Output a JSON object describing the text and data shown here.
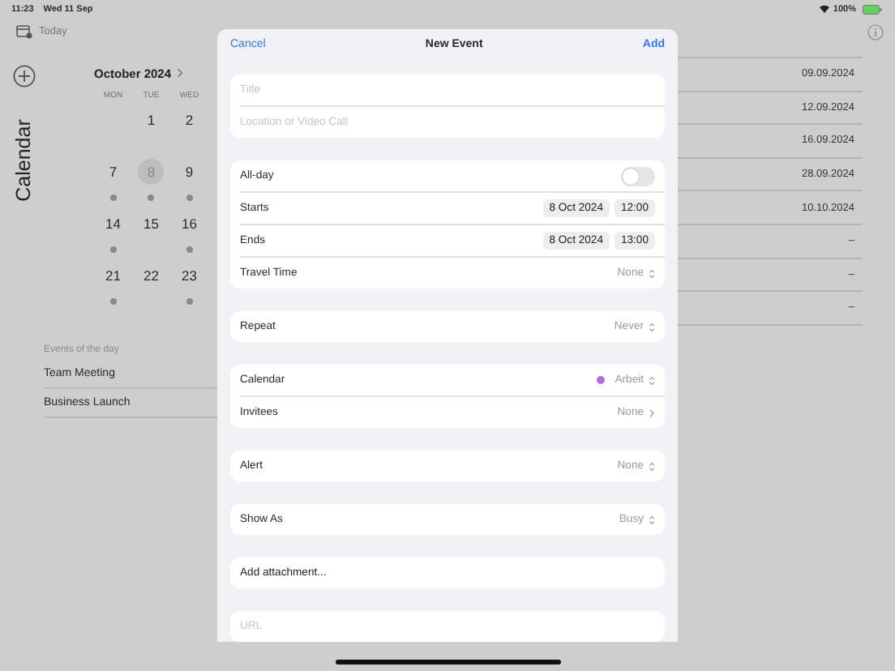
{
  "status_bar": {
    "time": "11:23",
    "date": "Wed 11 Sep",
    "battery": "100%"
  },
  "toolbar": {
    "today": "Today"
  },
  "sidebar": {
    "title": "Calendar"
  },
  "month": {
    "title": "October 2024",
    "weekdays": [
      "MON",
      "TUE",
      "WED"
    ],
    "weeks": [
      [
        {
          "day": "1",
          "has_events": false,
          "selected": false
        },
        {
          "day": "2",
          "has_events": false,
          "selected": false
        }
      ],
      [
        {
          "day": "7",
          "has_events": true,
          "selected": false
        },
        {
          "day": "8",
          "has_events": true,
          "selected": true
        },
        {
          "day": "9",
          "has_events": true,
          "selected": false
        }
      ],
      [
        {
          "day": "14",
          "has_events": true,
          "selected": false
        },
        {
          "day": "15",
          "has_events": false,
          "selected": false
        },
        {
          "day": "16",
          "has_events": true,
          "selected": false
        }
      ],
      [
        {
          "day": "21",
          "has_events": true,
          "selected": false
        },
        {
          "day": "22",
          "has_events": false,
          "selected": false
        },
        {
          "day": "23",
          "has_events": true,
          "selected": false
        }
      ]
    ]
  },
  "events": {
    "header": "Events of the day",
    "items": [
      "Team Meeting",
      "Business Launch"
    ]
  },
  "list": {
    "rows": [
      "09.09.2024",
      "12.09.2024",
      "16.09.2024",
      "28.09.2024",
      "10.10.2024",
      "–",
      "–",
      "–"
    ]
  },
  "modal": {
    "cancel": "Cancel",
    "title": "New Event",
    "add": "Add",
    "sections": [
      {
        "rows": [
          {
            "kind": "input",
            "placeholder": "Title"
          },
          {
            "kind": "input",
            "placeholder": "Location or Video Call"
          }
        ]
      },
      {
        "rows": [
          {
            "kind": "toggle",
            "label": "All-day",
            "on": false
          },
          {
            "kind": "datetime",
            "label": "Starts",
            "date": "8 Oct 2024",
            "time": "12:00"
          },
          {
            "kind": "datetime",
            "label": "Ends",
            "date": "8 Oct 2024",
            "time": "13:00"
          },
          {
            "kind": "picker",
            "label": "Travel Time",
            "value": "None"
          }
        ]
      },
      {
        "rows": [
          {
            "kind": "picker",
            "label": "Repeat",
            "value": "Never"
          }
        ]
      },
      {
        "rows": [
          {
            "kind": "picker",
            "label": "Calendar",
            "value": "Arbeit",
            "color": "#b86ad6"
          },
          {
            "kind": "disclosure",
            "label": "Invitees",
            "value": "None"
          }
        ]
      },
      {
        "rows": [
          {
            "kind": "picker",
            "label": "Alert",
            "value": "None"
          }
        ]
      },
      {
        "rows": [
          {
            "kind": "picker",
            "label": "Show As",
            "value": "Busy"
          }
        ]
      },
      {
        "rows": [
          {
            "kind": "action",
            "label": "Add attachment..."
          }
        ]
      },
      {
        "rows": [
          {
            "kind": "input",
            "placeholder": "URL"
          }
        ]
      }
    ]
  }
}
